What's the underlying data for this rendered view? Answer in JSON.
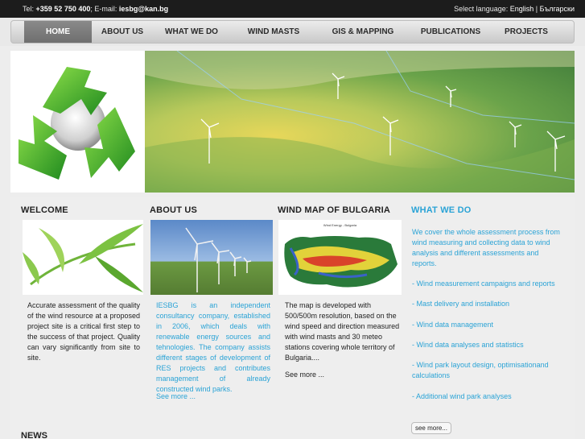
{
  "topbar": {
    "tel_label": "Tel:",
    "tel": "+359 52 750 400",
    "email_label": "; E-mail:",
    "email": "iesbg@kan.bg",
    "lang_label": "Select language:",
    "lang_en": "English",
    "lang_sep": "|",
    "lang_bg": "Български"
  },
  "nav": {
    "items": [
      {
        "label": "HOME",
        "active": true
      },
      {
        "label": "ABOUT US"
      },
      {
        "label": "WHAT WE DO"
      },
      {
        "label": "WIND MASTS"
      },
      {
        "label": "GIS & MAPPING"
      },
      {
        "label": "PUBLICATIONS"
      },
      {
        "label": "PROJECTS"
      }
    ]
  },
  "welcome": {
    "title": "WELCOME",
    "text": "Accurate assessment of the quality of the wind resource at a proposed project site is a critical first step to the success of that project. Quality can vary significantly from site to site."
  },
  "about": {
    "title": "ABOUT US",
    "text": "IESBG is an independent consultancy company, established in 2006, which deals with renewable energy sources and tehnologies. The company assists different stages of development of RES projects and contributes management of already constructed wind parks.",
    "more": "See more ..."
  },
  "windmap": {
    "title": "WIND MAP OF BULGARIA",
    "map_title": "Wind Energy - Bulgaria",
    "text": "The map is developed with 500/500m resolution, based on the wind speed and direction measured with wind masts and 30 meteo stations covering whole territory of Bulgaria....",
    "more": "See more ..."
  },
  "whatwedo": {
    "title": "WHAT WE DO",
    "intro": "We cover the whole assessment process from wind measuring and collecting data to wind analysis and different assessments and reports.",
    "services": [
      "- Wind measurement campaigns and reports",
      "- Mast delivery and installation",
      "- Wind data management",
      "- Wind data analyses and statistics",
      "- Wind park layout design, optimisationand calculations",
      "- Additional wind park analyses"
    ],
    "more": "see more..."
  },
  "news": {
    "title": "NEWS"
  }
}
